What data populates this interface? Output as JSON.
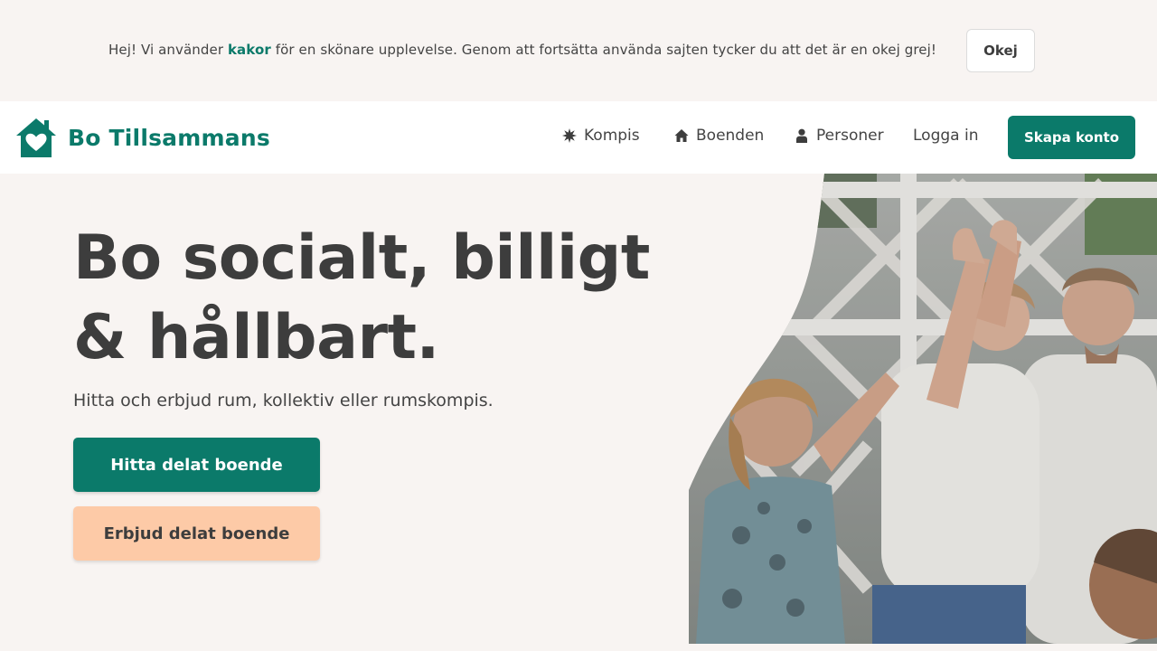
{
  "cookie": {
    "text_before": "Hej! Vi använder ",
    "link": "kakor",
    "text_after": " för en skönare upplevelse. Genom att fortsätta använda sajten tycker du att det är en okej grej!",
    "ok_label": "Okej"
  },
  "header": {
    "logo_text": "Bo Tillsammans",
    "nav": {
      "kompis": "Kompis",
      "boenden": "Boenden",
      "personer": "Personer",
      "login": "Logga in"
    },
    "signup_label": "Skapa konto"
  },
  "hero": {
    "title_line1": "Bo socialt, billigt",
    "title_line2": "& hållbart.",
    "subtitle": "Hitta och erbjud rum, kollektiv eller rumskompis.",
    "primary_cta": "Hitta delat boende",
    "secondary_cta": "Erbjud delat boende"
  },
  "colors": {
    "brand": "#0b7a6a",
    "accent_peach": "#fdcaa7",
    "background": "#f8f4f2",
    "text": "#3d3d3d"
  },
  "icons": [
    "house-heart-icon",
    "star-burst-icon",
    "home-icon",
    "user-icon"
  ]
}
